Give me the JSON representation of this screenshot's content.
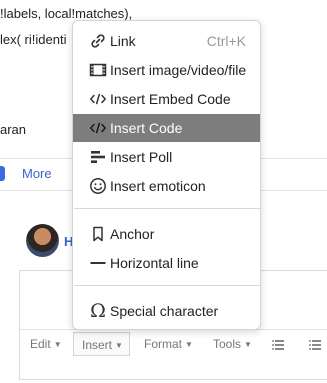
{
  "background": {
    "line1": "!labels, local!matches),",
    "line2": "lex( ri!identi",
    "line3": "aran",
    "more_label": "More",
    "editor_toolbar": {
      "edit": "Edit",
      "insert": "Insert",
      "format": "Format",
      "tools": "Tools"
    },
    "colors": {
      "accent": "#3d6ae0",
      "link": "#3a64c8"
    }
  },
  "menu": {
    "items": [
      {
        "label": "Link",
        "shortcut": "Ctrl+K",
        "icon": "link-icon"
      },
      {
        "label": "Insert image/video/file",
        "icon": "image-video-file-icon"
      },
      {
        "label": "Insert Embed Code",
        "icon": "embed-code-icon"
      },
      {
        "label": "Insert Code",
        "icon": "code-icon",
        "active": true
      },
      {
        "label": "Insert Poll",
        "icon": "poll-icon"
      },
      {
        "label": "Insert emoticon",
        "icon": "smiley-icon"
      },
      {
        "label": "Anchor",
        "icon": "bookmark-icon"
      },
      {
        "label": "Horizontal line",
        "icon": "horizontal-line-icon"
      },
      {
        "label": "Special character",
        "icon": "omega-icon"
      }
    ],
    "active_color": "#7d7d7d"
  }
}
